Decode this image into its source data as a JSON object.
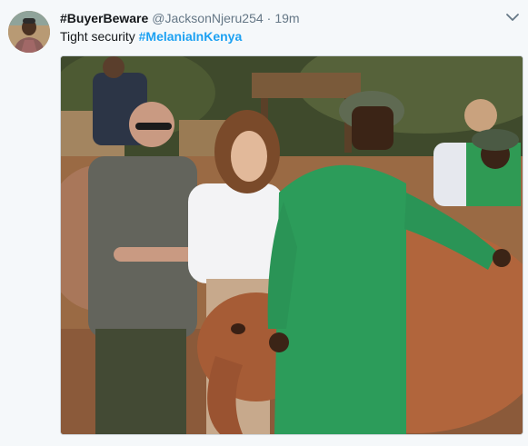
{
  "tweet": {
    "display_name": "#BuyerBeware",
    "handle": "@JacksonNjeru254",
    "separator": "·",
    "time": "19m",
    "text_plain": "Tight security ",
    "hashtag": "#MelaniaInKenya"
  },
  "icons": {
    "avatar": "user-avatar-photo",
    "menu": "chevron-down-icon"
  },
  "colors": {
    "background": "#f5f8fa",
    "hashtag": "#1da1f2",
    "meta_text": "#657786"
  }
}
